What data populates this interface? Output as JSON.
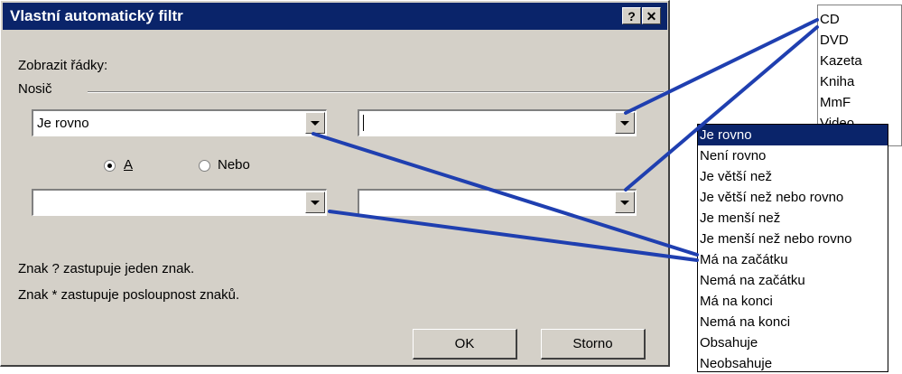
{
  "dialog": {
    "title": "Vlastní automatický filtr",
    "help_btn": "?",
    "close_btn": "✕",
    "show_rows_label": "Zobrazit řádky:",
    "group_label": "Nosič",
    "row1": {
      "operator": "Je rovno",
      "value": ""
    },
    "row2": {
      "operator": "",
      "value": ""
    },
    "radio_and": "A",
    "radio_or": "Nebo",
    "hint1": "Znak ? zastupuje jeden znak.",
    "hint2": "Znak * zastupuje posloupnost znaků.",
    "ok": "OK",
    "cancel": "Storno"
  },
  "values_list": [
    "CD",
    "DVD",
    "Kazeta",
    "Kniha",
    "MmF",
    "Video"
  ],
  "operators_list": [
    "Je rovno",
    "Není rovno",
    "Je větší než",
    "Je větší než nebo rovno",
    "Je menší než",
    "Je menší než nebo rovno",
    "Má na začátku",
    "Nemá na začátku",
    "Má na konci",
    "Nemá na konci",
    "Obsahuje",
    "Neobsahuje"
  ],
  "colors": {
    "title_bar": "#0a246a",
    "dialog_bg": "#d4d0c8",
    "arrow": "#1f3fb0"
  }
}
